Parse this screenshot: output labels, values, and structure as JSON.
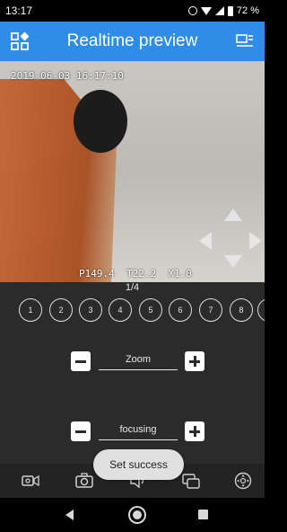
{
  "status_bar": {
    "time": "13:17",
    "battery": "72 %"
  },
  "header": {
    "title": "Realtime preview",
    "left_icon": "grid-icon",
    "right_icon": "list-icon"
  },
  "video": {
    "osd_timestamp": "2019-06-03 16:17:10",
    "osd_ptz": "P149.4  T22.2  X1.0"
  },
  "presets": {
    "page": "1/4",
    "items": [
      "1",
      "2",
      "3",
      "4",
      "5",
      "6",
      "7",
      "8"
    ]
  },
  "zoom": {
    "label": "Zoom"
  },
  "focus": {
    "label": "focusing"
  },
  "toast": {
    "message": "Set success"
  },
  "toolbar": {
    "icons": [
      "record-icon",
      "camera-icon",
      "audio-icon",
      "multi-window-icon",
      "ptz-icon"
    ]
  },
  "colors": {
    "header": "#2f8ce8",
    "panel": "#2b2b2b"
  }
}
